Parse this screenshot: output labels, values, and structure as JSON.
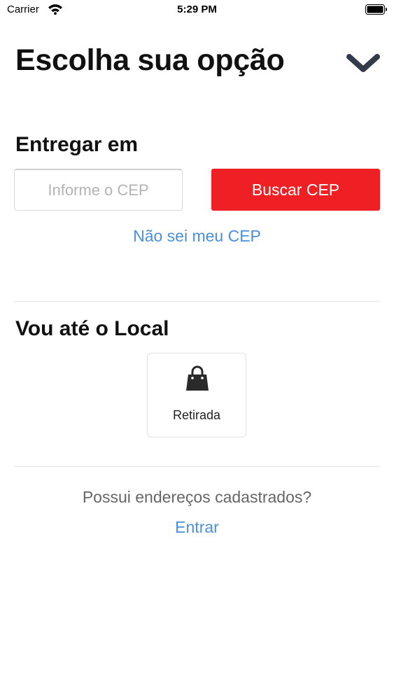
{
  "status_bar": {
    "carrier": "Carrier",
    "time": "5:29 PM"
  },
  "header": {
    "title": "Escolha sua opção",
    "collapse_icon": "chevron-down-icon"
  },
  "delivery": {
    "heading": "Entregar em",
    "cep_placeholder": "Informe o CEP",
    "cep_value": "",
    "search_label": "Buscar CEP",
    "unknown_cep_link": "Não sei meu CEP"
  },
  "pickup": {
    "heading": "Vou até o Local",
    "option_label": "Retirada",
    "option_icon": "shopping-bag-icon"
  },
  "footer": {
    "question": "Possui endereços cadastrados?",
    "login_link": "Entrar"
  },
  "colors": {
    "accent_red": "#ee2024",
    "link_blue": "#4a90d9",
    "chevron": "#333b4a"
  }
}
